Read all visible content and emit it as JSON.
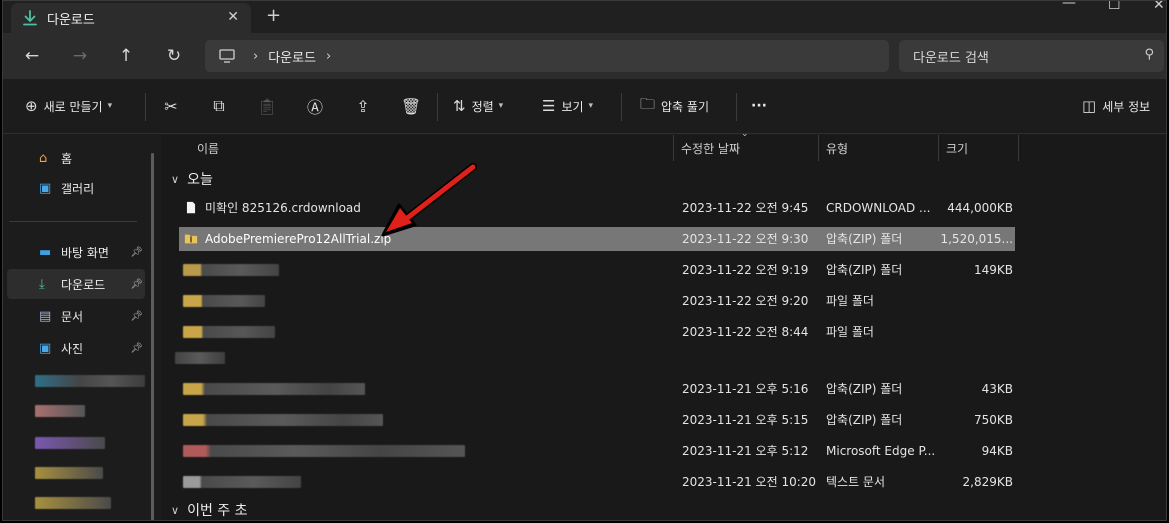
{
  "window": {
    "tab_title": "다운로드"
  },
  "nav": {
    "breadcrumb": "다운로드",
    "search_placeholder": "다운로드 검색"
  },
  "toolbar": {
    "new_label": "새로 만들기",
    "sort_label": "정렬",
    "view_label": "보기",
    "extract_label": "압축 풀기",
    "more_label": "···",
    "details_label": "세부 정보"
  },
  "sidebar": {
    "items": [
      {
        "label": "홈",
        "icon": "home-icon",
        "pinned": false
      },
      {
        "label": "갤러리",
        "icon": "gallery-icon",
        "pinned": false
      },
      {
        "label": "바탕 화면",
        "icon": "desktop-icon",
        "pinned": true
      },
      {
        "label": "다운로드",
        "icon": "download-icon",
        "pinned": true,
        "active": true
      },
      {
        "label": "문서",
        "icon": "document-icon",
        "pinned": true
      },
      {
        "label": "사진",
        "icon": "pictures-icon",
        "pinned": true
      }
    ]
  },
  "columns": {
    "name": "이름",
    "modified": "수정한 날짜",
    "type": "유형",
    "size": "크기"
  },
  "groups": {
    "today": "오늘",
    "this_week": "이번 주 초"
  },
  "files": [
    {
      "name": "미확인 825126.crdownload",
      "modified": "2023-11-22 오전 9:45",
      "type": "CRDOWNLOAD ...",
      "size": "444,000KB",
      "icon": "file-icon",
      "selected": false
    },
    {
      "name": "AdobePremierePro12AllTrial.zip",
      "modified": "2023-11-22 오전 9:30",
      "type": "압축(ZIP) 폴더",
      "size": "1,520,015...",
      "icon": "zip-folder-icon",
      "selected": true
    },
    {
      "name": "",
      "modified": "2023-11-22 오전 9:19",
      "type": "압축(ZIP) 폴더",
      "size": "149KB",
      "icon": "zip-folder-icon",
      "selected": false
    },
    {
      "name": "",
      "modified": "2023-11-22 오전 9:20",
      "type": "파일 폴더",
      "size": "",
      "icon": "folder-icon",
      "selected": false
    },
    {
      "name": "",
      "modified": "2023-11-22 오전 8:44",
      "type": "파일 폴더",
      "size": "",
      "icon": "folder-icon",
      "selected": false
    },
    {
      "name": "",
      "modified": "",
      "type": "",
      "size": "",
      "icon": "blurred-icon",
      "selected": false
    },
    {
      "name": "",
      "modified": "2023-11-21 오후 5:16",
      "type": "압축(ZIP) 폴더",
      "size": "43KB",
      "icon": "zip-folder-icon",
      "selected": false
    },
    {
      "name": "",
      "modified": "2023-11-21 오후 5:15",
      "type": "압축(ZIP) 폴더",
      "size": "750KB",
      "icon": "zip-folder-icon",
      "selected": false
    },
    {
      "name": "",
      "modified": "2023-11-21 오후 5:12",
      "type": "Microsoft Edge P...",
      "size": "94KB",
      "icon": "pdf-icon",
      "selected": false
    },
    {
      "name": "",
      "modified": "2023-11-21 오전 10:20",
      "type": "텍스트 문서",
      "size": "2,829KB",
      "icon": "text-file-icon",
      "selected": false
    }
  ],
  "colors": {
    "accent": "#4cc2a3",
    "arrow": "#e0201a",
    "selected_row": "#777777"
  }
}
